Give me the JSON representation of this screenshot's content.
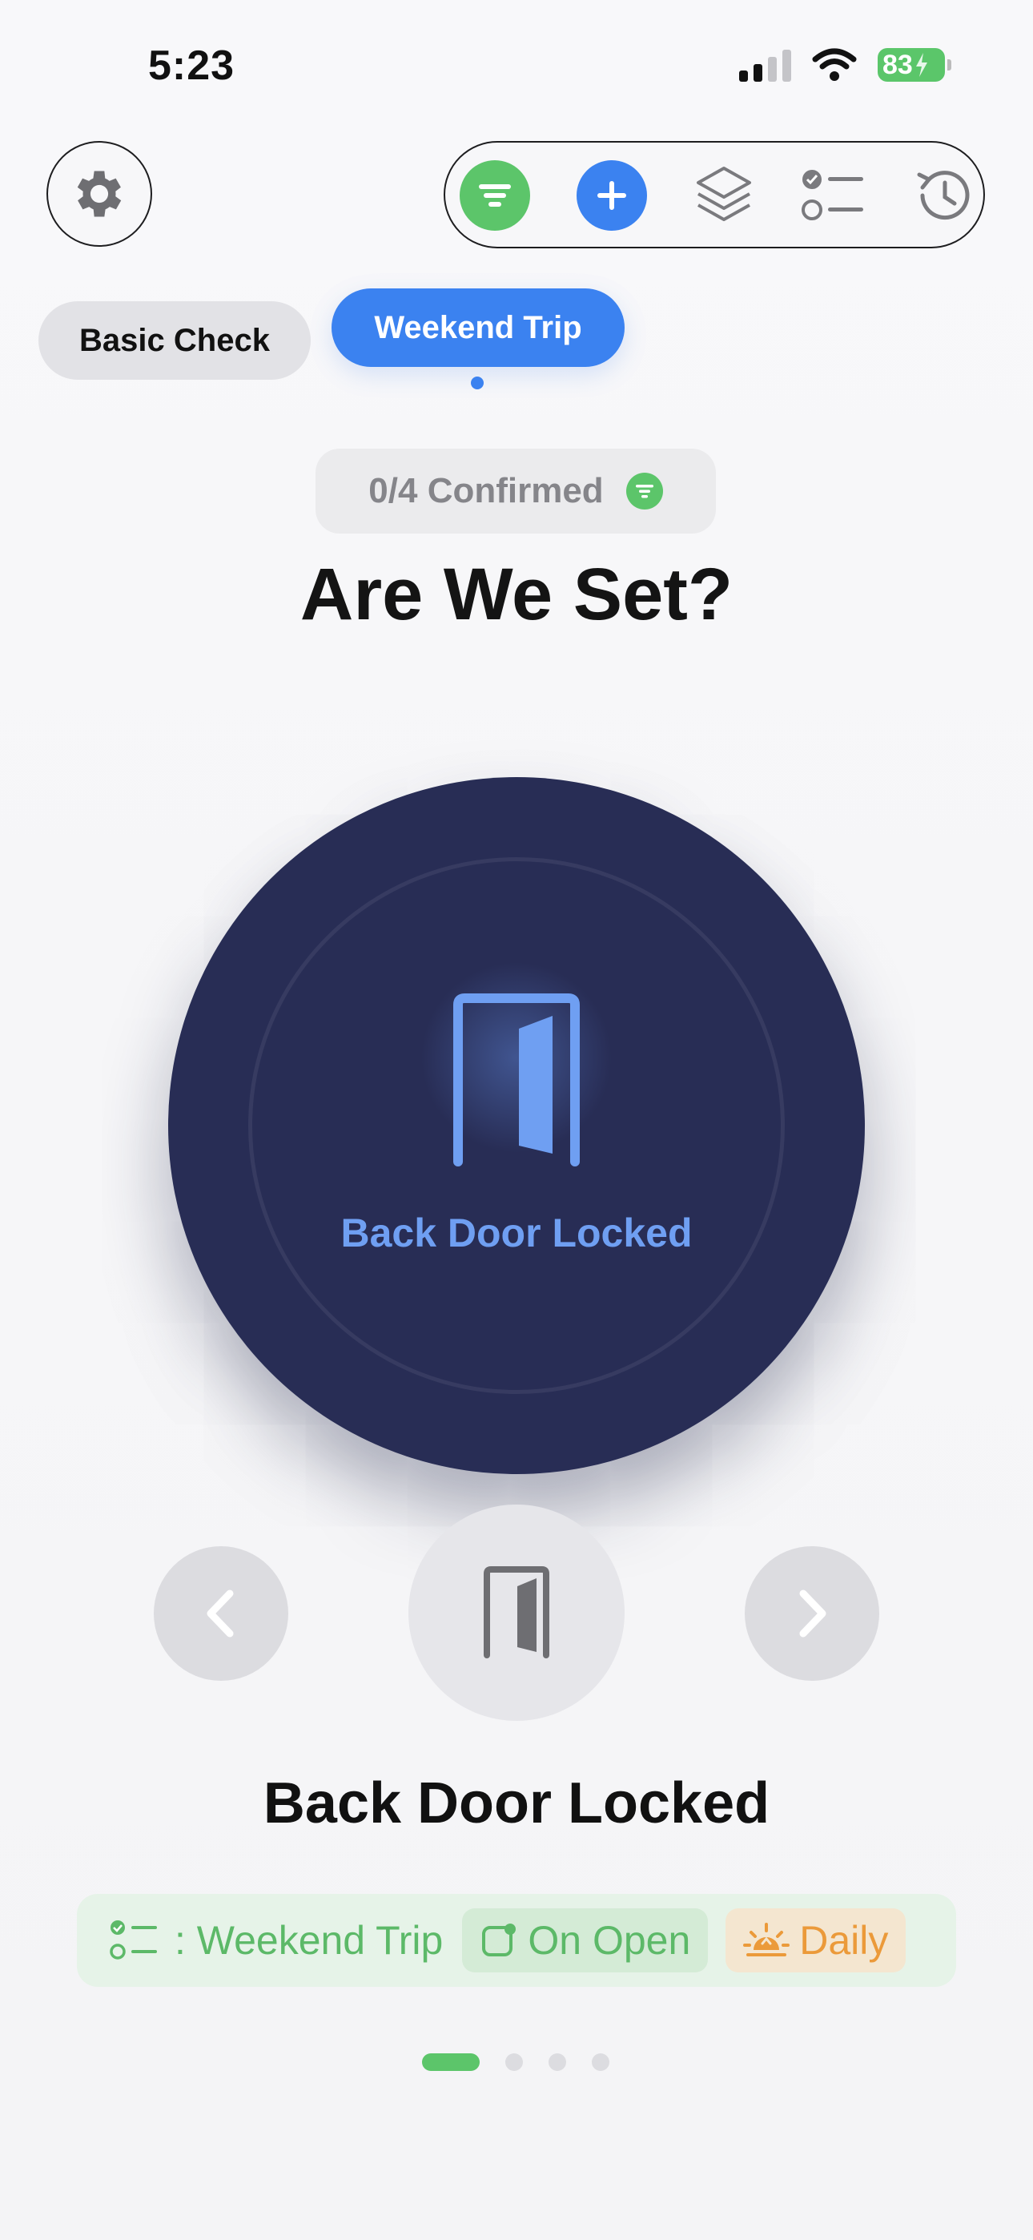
{
  "status_bar": {
    "time": "5:23",
    "battery": "83",
    "icons": [
      "signal-icon",
      "wifi-icon",
      "battery-icon",
      "charging-bolt-icon"
    ]
  },
  "toolbar": {
    "icons": [
      "gear-icon",
      "filter-icon",
      "plus-icon",
      "layers-icon",
      "checklist-icon",
      "history-icon"
    ]
  },
  "tabs": [
    {
      "label": "Basic Check",
      "selected": false
    },
    {
      "label": "Weekend Trip",
      "selected": true
    }
  ],
  "progress": {
    "label": "0/4 Confirmed"
  },
  "title": "Are We Set?",
  "current_item": {
    "circle_label": "Back Door Locked",
    "name": "Back Door Locked",
    "icon": "door-icon"
  },
  "info": {
    "list": ": Weekend Trip",
    "trigger": "On Open",
    "schedule": "Daily"
  },
  "pager": {
    "total": 4,
    "current": 1
  },
  "colors": {
    "accent_blue": "#3b82f0",
    "accent_green": "#5cc56a",
    "circle_navy": "#282d55",
    "orange": "#eb9a3a"
  }
}
